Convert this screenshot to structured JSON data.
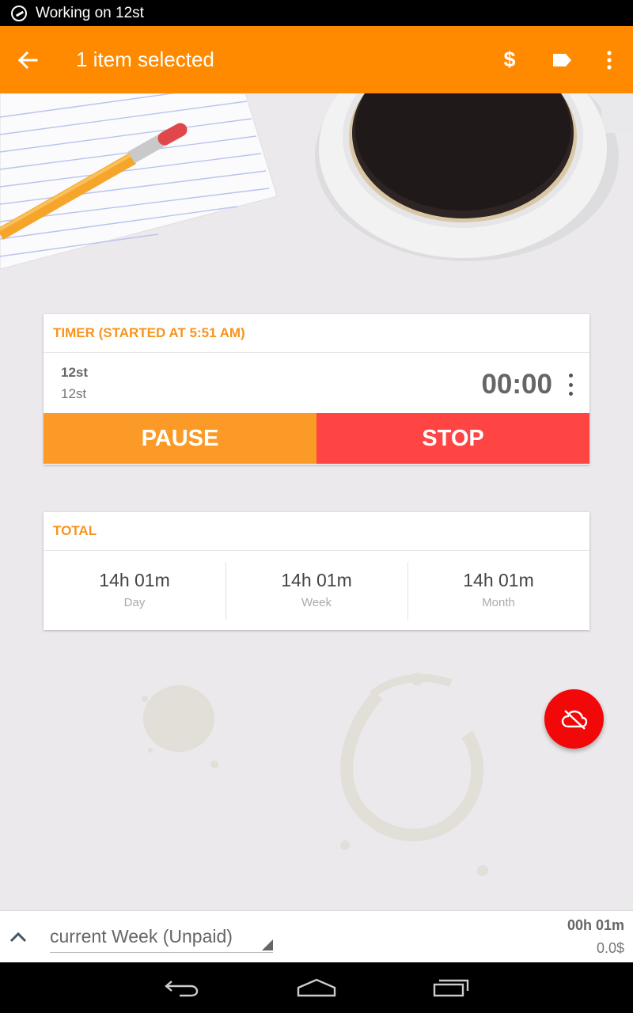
{
  "status_bar": {
    "notification_text": "Working on 12st"
  },
  "action_bar": {
    "title": "1 item selected",
    "dollar_label": "$"
  },
  "timer_card": {
    "header": "TIMER (STARTED AT 5:51 AM)",
    "project": "12st",
    "task": "12st",
    "elapsed": "00:00",
    "pause_label": "PAUSE",
    "stop_label": "STOP"
  },
  "total_card": {
    "header": "TOTAL",
    "columns": [
      {
        "value": "14h 01m",
        "label": "Day"
      },
      {
        "value": "14h 01m",
        "label": "Week"
      },
      {
        "value": "14h 01m",
        "label": "Month"
      }
    ]
  },
  "bottom_bar": {
    "period": "current Week (Unpaid)",
    "duration": "00h 01m",
    "amount": "0.0$"
  },
  "colors": {
    "accent": "#ff8a00",
    "pause": "#fb9a26",
    "stop": "#ff4444",
    "fab": "#f20808",
    "header_text": "#f7941d"
  },
  "icons": {
    "status": "stopwatch-icon",
    "back": "arrow-back-icon",
    "tag": "label-tag-icon",
    "more": "more-vert-icon",
    "fab": "cloud-off-icon",
    "expand": "chevron-up-icon"
  }
}
